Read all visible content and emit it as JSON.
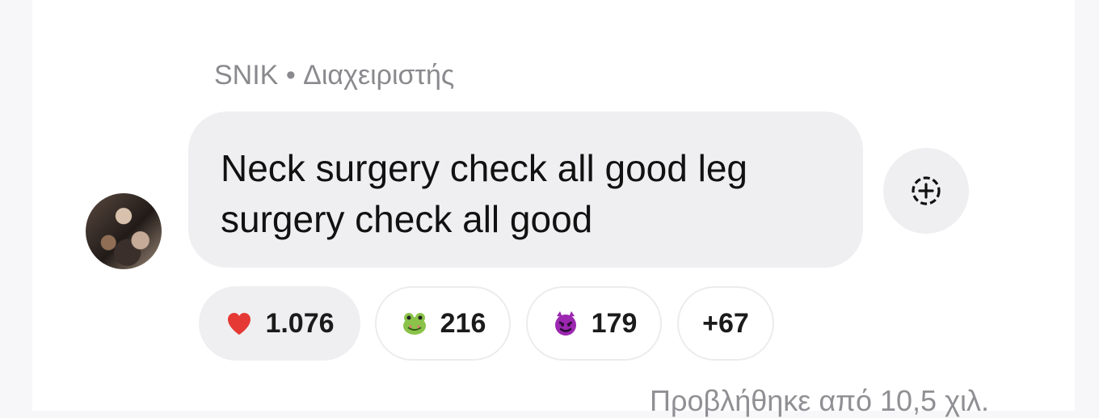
{
  "message": {
    "sender": "SNIK",
    "separator": "•",
    "role": "Διαχειριστής",
    "text_line_1": "Neck surgery check all good leg",
    "text_line_2": "surgery check all good"
  },
  "reactions": [
    {
      "emoji": "❤️",
      "icon": "heart-icon",
      "count": "1.076",
      "selected": true
    },
    {
      "emoji": "🐸",
      "icon": "frog-icon",
      "count": "216",
      "selected": false
    },
    {
      "emoji": "😈",
      "icon": "devil-icon",
      "count": "179",
      "selected": false
    },
    {
      "count": "+67",
      "selected": false
    }
  ],
  "footer": {
    "seen_text": "Προβλήθηκε από 10,5 χιλ."
  },
  "colors": {
    "bubble": "#efeff1",
    "muted_text": "#8a8a8e",
    "heart": "#e53935",
    "frog": "#8bc34a",
    "devil": "#9c27b0"
  }
}
